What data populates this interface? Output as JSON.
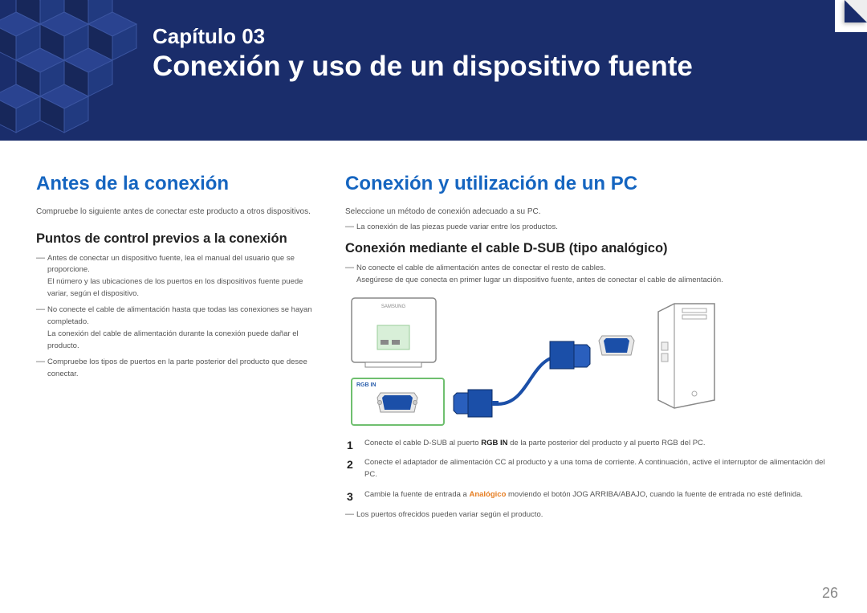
{
  "header": {
    "chapter_label": "Capítulo 03",
    "chapter_title": "Conexión y uso de un dispositivo fuente"
  },
  "left": {
    "section_title": "Antes de la conexión",
    "intro": "Compruebe lo siguiente antes de conectar este producto a otros dispositivos.",
    "subsection_title": "Puntos de control previos a la conexión",
    "bullets": {
      "b1a": "Antes de conectar un dispositivo fuente, lea el manual del usuario que se proporcione.",
      "b1b": "El número y las ubicaciones de los puertos en los dispositivos fuente puede variar, según el dispositivo.",
      "b2a": "No conecte el cable de alimentación hasta que todas las conexiones se hayan completado.",
      "b2b": "La conexión del cable de alimentación durante la conexión puede dañar el producto.",
      "b3": "Compruebe los tipos de puertos en la parte posterior del producto que desee conectar."
    }
  },
  "right": {
    "section_title": "Conexión y utilización de un PC",
    "intro": "Seleccione un método de conexión adecuado a su PC.",
    "note_top": "La conexión de las piezas puede variar entre los productos.",
    "subsection_title": "Conexión mediante el cable D-SUB (tipo analógico)",
    "warn1": "No conecte el cable de alimentación antes de conectar el resto de cables.",
    "warn1b": "Asegúrese de que conecta en primer lugar un dispositivo fuente, antes de conectar el cable de alimentación.",
    "diagram": {
      "monitor_label": "SAMSUNG",
      "port_label": "RGB IN"
    },
    "steps": {
      "s1_a": "Conecte el cable D-SUB al puerto ",
      "s1_bold": "RGB IN",
      "s1_b": " de la parte posterior del producto y al puerto RGB del PC.",
      "s2": "Conecte el adaptador de alimentación CC al producto y a una toma de corriente. A continuación, active el interruptor de alimentación del PC.",
      "s3_a": "Cambie la fuente de entrada a ",
      "s3_orange": "Analógico",
      "s3_b": " moviendo el botón JOG ARRIBA/ABAJO, cuando la fuente de entrada no esté definida."
    },
    "note_bottom": "Los puertos ofrecidos pueden variar según el producto."
  },
  "page_number": "26"
}
